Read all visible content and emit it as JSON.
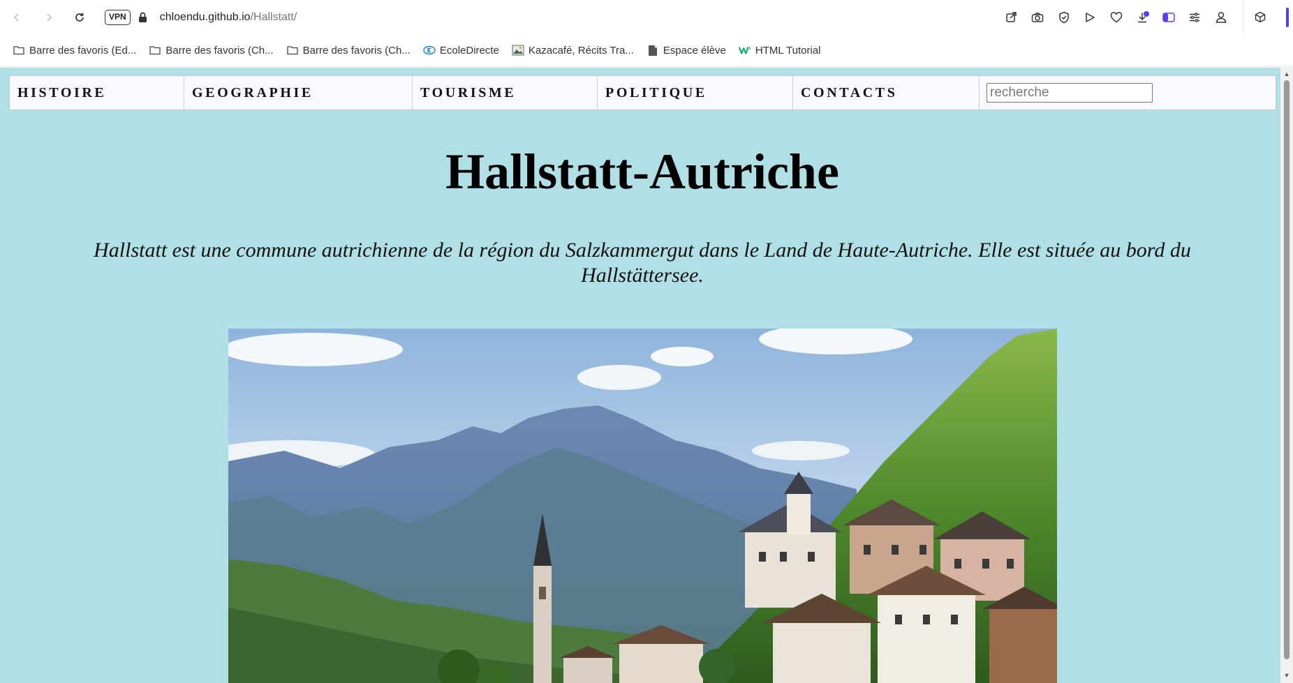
{
  "browser": {
    "vpn_label": "VPN",
    "url_host": "chloendu.github.io",
    "url_path": "/Hallstatt/",
    "bookmarks": [
      {
        "label": "Barre des favoris (Ed...",
        "icon": "folder-icon"
      },
      {
        "label": "Barre des favoris (Ch...",
        "icon": "folder-icon"
      },
      {
        "label": "Barre des favoris (Ch...",
        "icon": "folder-icon"
      },
      {
        "label": "EcoleDirecte",
        "icon": "ecoledirecte-icon"
      },
      {
        "label": "Kazacafé, Récits Tra...",
        "icon": "image-icon"
      },
      {
        "label": "Espace élève",
        "icon": "file-icon"
      },
      {
        "label": "HTML Tutorial",
        "icon": "w3schools-icon"
      }
    ],
    "accent_color": "#5b3cf0"
  },
  "site": {
    "nav": {
      "items": [
        "HISTOIRE",
        "GEOGRAPHIE",
        "TOURISME",
        "POLITIQUE",
        "CONTACTS"
      ],
      "search_placeholder": "recherche"
    },
    "title": "Hallstatt-Autriche",
    "intro": "Hallstatt est une commune autrichienne de la région du Salzkammergut dans le Land de Haute-Autriche. Elle est située au bord du Hallstättersee.",
    "background_color": "#b0dfe5",
    "hero_image": "hallstatt-village-mountains-photo"
  }
}
